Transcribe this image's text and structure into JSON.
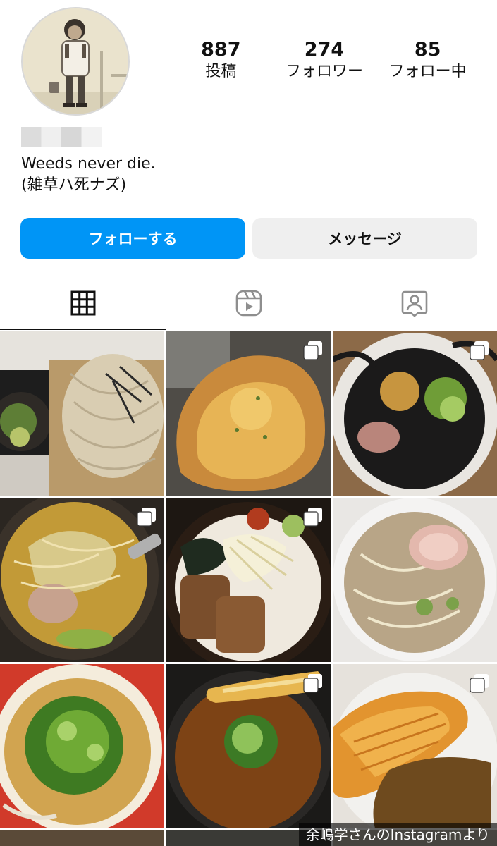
{
  "profile": {
    "stats": [
      {
        "value": "887",
        "label": "投稿"
      },
      {
        "value": "274",
        "label": "フォロワー"
      },
      {
        "value": "85",
        "label": "フォロー中"
      }
    ],
    "bio_line1": "Weeds never die.",
    "bio_line2": "(雑草ハ死ナズ)"
  },
  "actions": {
    "follow_label": "フォローする",
    "message_label": "メッセージ"
  },
  "tabs": [
    {
      "icon": "grid-icon",
      "active": true
    },
    {
      "icon": "reels-icon",
      "active": false
    },
    {
      "icon": "tagged-icon",
      "active": false
    }
  ],
  "posts": [
    {
      "subject": "zaru soba",
      "multi": false
    },
    {
      "subject": "cheese bread",
      "multi": true
    },
    {
      "subject": "black garlic ramen",
      "multi": true
    },
    {
      "subject": "miso vegetable ramen",
      "multi": true
    },
    {
      "subject": "tonkotsu chashu ramen",
      "multi": true
    },
    {
      "subject": "shoyu ramen",
      "multi": false
    },
    {
      "subject": "negi ramen",
      "multi": false
    },
    {
      "subject": "curry udon with tempura",
      "multi": true
    },
    {
      "subject": "katsu curry",
      "multi": true
    }
  ],
  "colors": {
    "primary_blue": "#0095f6",
    "secondary_gray": "#efefef"
  },
  "watermark": "余嶋学さんのInstagramより"
}
